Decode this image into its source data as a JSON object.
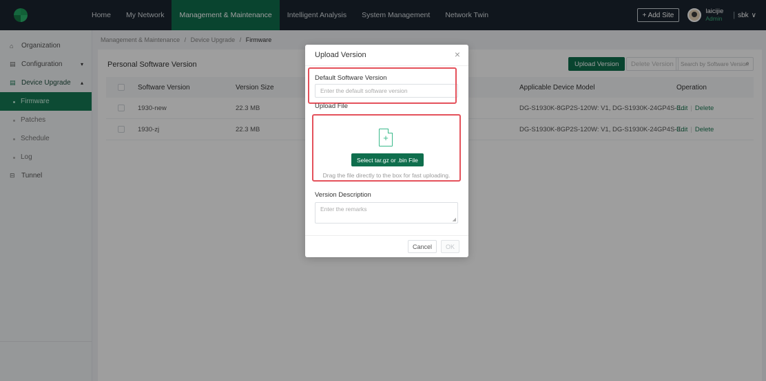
{
  "nav": {
    "items": [
      "Home",
      "My Network",
      "Management & Maintenance",
      "Intelligent Analysis",
      "System Management",
      "Network Twin"
    ],
    "active_index": 2
  },
  "header": {
    "add_site": "+ Add Site",
    "user_name": "laicijie",
    "user_role": "Admin",
    "separator": "|",
    "tenant": "sbk",
    "tenant_chevron": "∨"
  },
  "sidebar": {
    "organization": "Organization",
    "configuration": "Configuration",
    "device_upgrade": "Device Upgrade",
    "firmware": "Firmware",
    "patches": "Patches",
    "schedule": "Schedule",
    "log": "Log",
    "tunnel": "Tunnel"
  },
  "breadcrumb": {
    "part1": "Management & Maintenance",
    "part2": "Device Upgrade",
    "current": "Firmware",
    "separator": "/"
  },
  "panel": {
    "title": "Personal Software Version",
    "upload_button": "Upload Version",
    "delete_button": "Delete Version",
    "search_placeholder": "Search by Software Version"
  },
  "table": {
    "columns": [
      "Software Version",
      "Version Size",
      "Applicable Device Model",
      "Operation"
    ],
    "rows": [
      {
        "version": "1930-new",
        "size": "22.3 MB",
        "model": "DG-S1930K-8GP2S-120W: V1, DG-S1930K-24GP4S-3...",
        "edit": "Edit",
        "delete": "Delete"
      },
      {
        "version": "1930-zj",
        "size": "22.3 MB",
        "model": "DG-S1930K-8GP2S-120W: V1, DG-S1930K-24GP4S-3...",
        "edit": "Edit",
        "delete": "Delete"
      }
    ]
  },
  "modal": {
    "title": "Upload Version",
    "close": "×",
    "default_version_label": "Default Software Version",
    "default_version_placeholder": "Enter the default software version",
    "upload_file_label": "Upload File",
    "select_file_button": "Select tar.gz or .bin File",
    "drag_hint": "Drag the file directly to the box for fast uploading.",
    "description_label": "Version Description",
    "description_placeholder": "Enter the remarks",
    "cancel": "Cancel",
    "ok": "OK"
  },
  "colors": {
    "brand": "#0f6e4d",
    "highlight": "#e4505a",
    "topbar": "#1a2530"
  }
}
